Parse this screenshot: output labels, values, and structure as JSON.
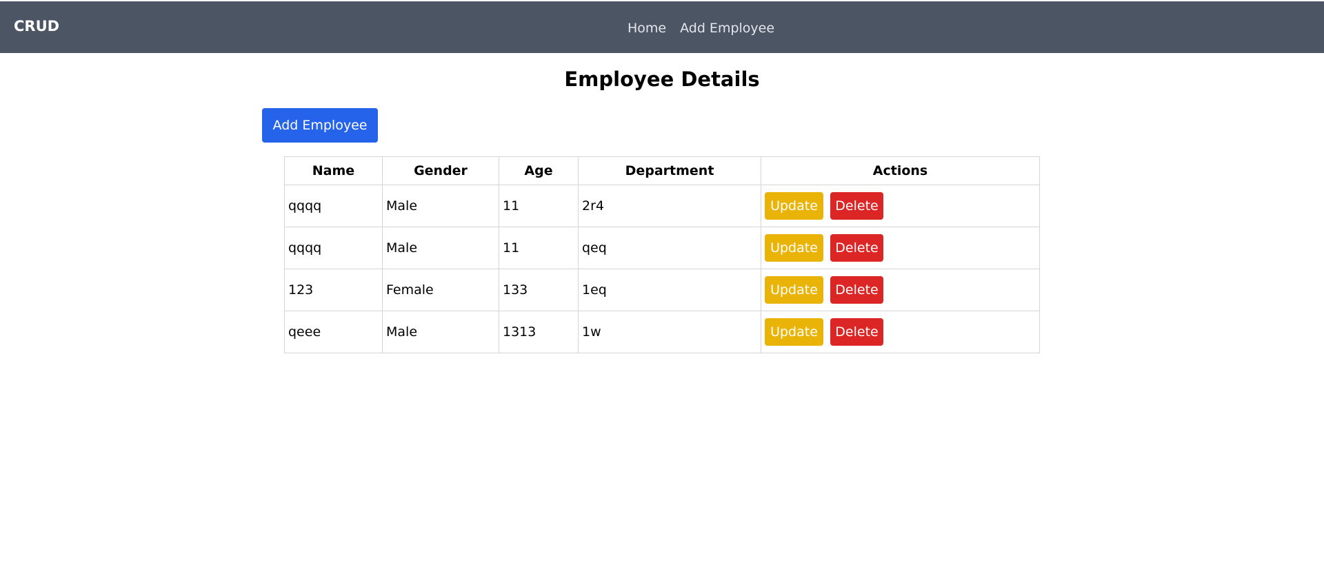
{
  "navbar": {
    "brand": "CRUD",
    "links": [
      "Home",
      "Add Employee"
    ]
  },
  "page": {
    "title": "Employee Details",
    "add_button_label": "Add Employee"
  },
  "colors": {
    "navbar_bg": "#4b5563",
    "primary": "#2563eb",
    "update": "#eab308",
    "delete": "#dc2626"
  },
  "table": {
    "headers": [
      "Name",
      "Gender",
      "Age",
      "Department",
      "Actions"
    ],
    "rows": [
      {
        "name": "qqqq",
        "gender": "Male",
        "age": "11",
        "department": "2r4"
      },
      {
        "name": "qqqq",
        "gender": "Male",
        "age": "11",
        "department": "qeq"
      },
      {
        "name": "123",
        "gender": "Female",
        "age": "133",
        "department": "1eq"
      },
      {
        "name": "qeee",
        "gender": "Male",
        "age": "1313",
        "department": "1w"
      }
    ],
    "update_label": "Update",
    "delete_label": "Delete"
  }
}
